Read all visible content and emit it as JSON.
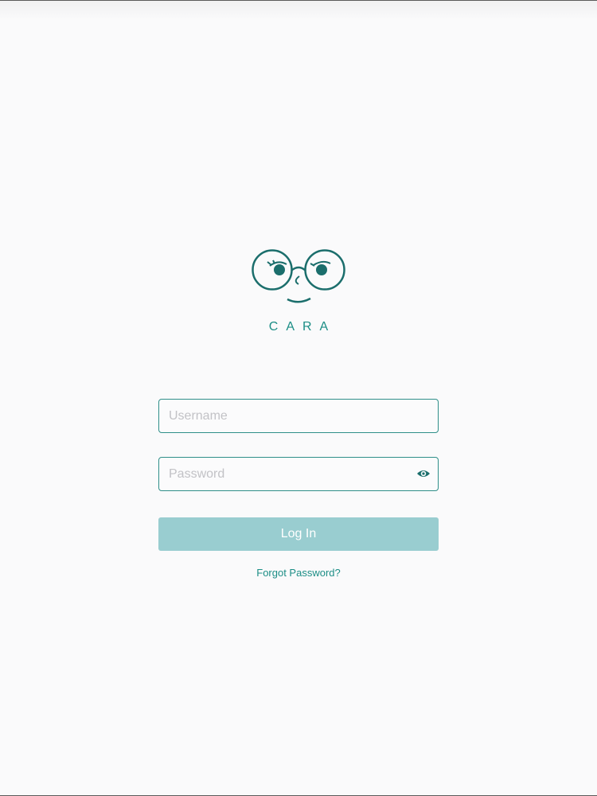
{
  "brand": {
    "name": "CARA",
    "logo_icon": "glasses-face-icon"
  },
  "login_form": {
    "username": {
      "placeholder": "Username",
      "value": ""
    },
    "password": {
      "placeholder": "Password",
      "value": "",
      "toggle_icon": "eye-icon"
    },
    "login_label": "Log In",
    "forgot_password_label": "Forgot Password?"
  },
  "colors": {
    "brand_teal": "#1c8e86",
    "field_border": "#2f8f89",
    "button_disabled": "#99cdd0",
    "background": "#fafafb",
    "placeholder": "#c2c2c6"
  }
}
